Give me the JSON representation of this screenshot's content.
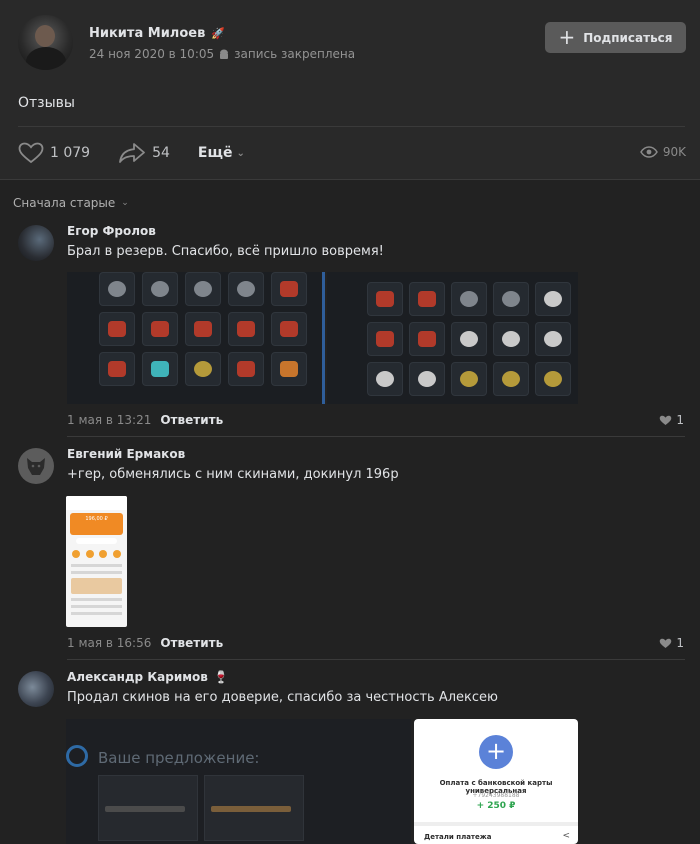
{
  "post": {
    "author_name": "Никита Милоев",
    "date": "24 ноя 2020 в 10:05",
    "pinned_label": "запись закреплена",
    "subscribe_label": "Подписаться",
    "text": "Отзывы",
    "likes": "1 079",
    "shares": "54",
    "more_label": "Ещё",
    "views": "90K"
  },
  "sort_label": "Сначала старые",
  "reply_label": "Ответить",
  "comments": [
    {
      "author": "Егор Фролов",
      "text": "Брал в резерв. Спасибо, всё пришло вовремя!",
      "time": "1 мая в 13:21",
      "likes": "1"
    },
    {
      "author": "Евгений Ермаков",
      "text": "+гер, обменялись с ним скинами, докинул 196р",
      "time": "1 мая в 16:56",
      "likes": "1"
    },
    {
      "author": "Александр Каримов",
      "text": "Продал скинов на его доверие, спасибо за честность Алексею",
      "time": "",
      "likes": ""
    }
  ],
  "attachments": {
    "phone_amount": "196,00 ₽",
    "offer_title": "Ваше предложение:",
    "payment_title": "Оплата с банковской карты универсальная",
    "payment_phone": "+79243988188",
    "payment_amount": "+ 250 ₽",
    "payment_details": "Детали платежа"
  },
  "colors": {
    "background": "#222222",
    "card": "#292929",
    "accent_button": "#5a5a5a",
    "text": "#e1e3e6",
    "muted": "#8a8a8a"
  },
  "icons": [
    "android-icon",
    "plus-icon",
    "heart-icon",
    "share-icon",
    "chevron-down-icon",
    "eye-icon"
  ]
}
